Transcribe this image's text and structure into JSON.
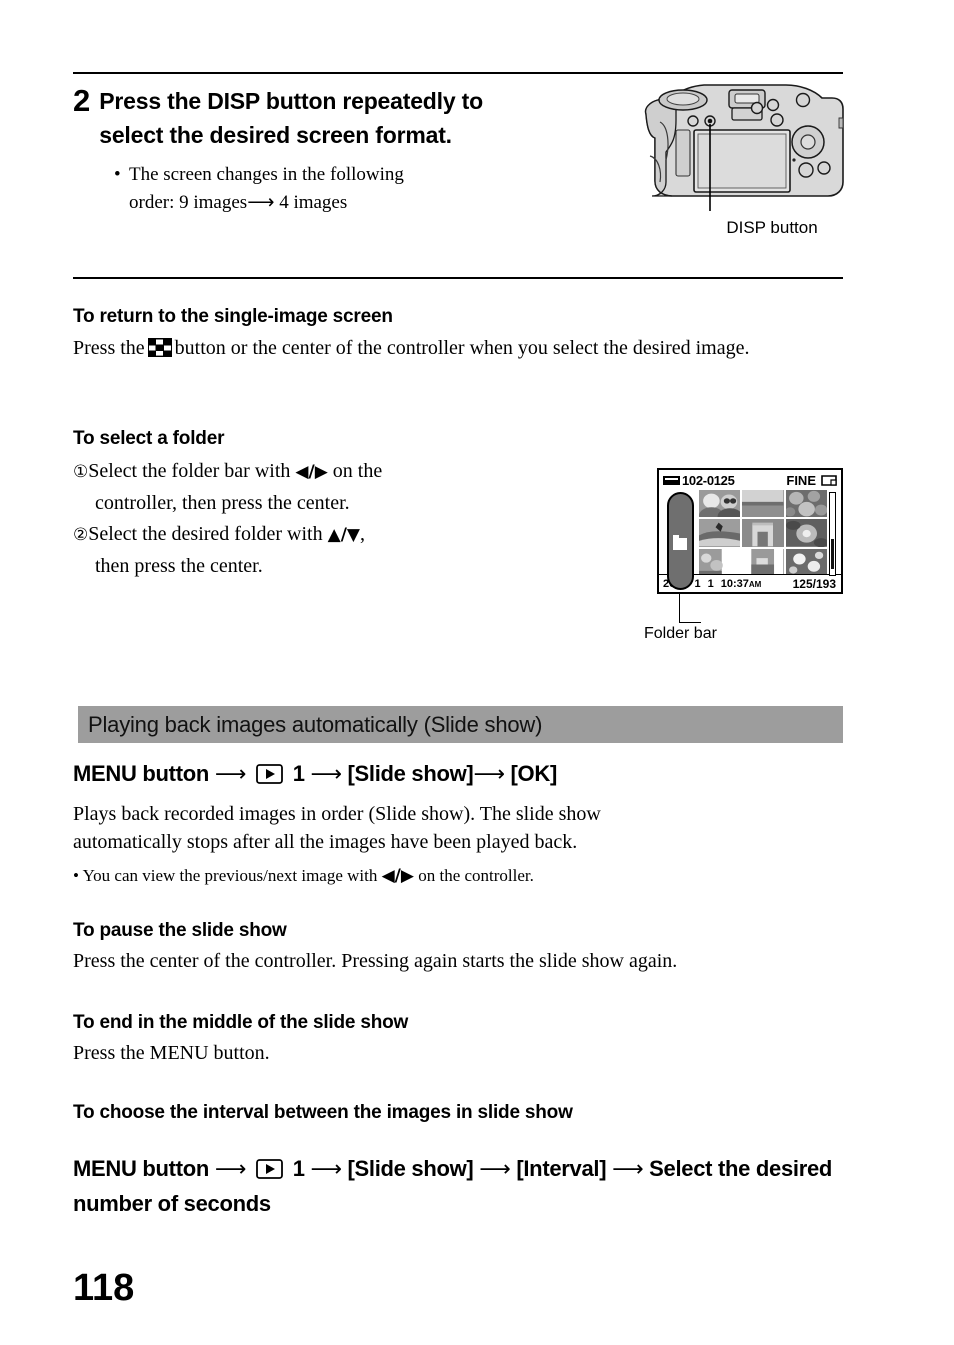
{
  "page": {
    "number": "118"
  },
  "step": {
    "number": "2",
    "title": "Press the DISP button repeatedly to select the desired screen format.",
    "bullet_dot": "•",
    "bullet_line1": "The screen changes in the following",
    "bullet_line2_pre": "order: 9 images",
    "bullet_arrow": "⟶",
    "bullet_line2_post": "4 images"
  },
  "camera_figure": {
    "caption": "DISP button",
    "icon": "camera-rear-illustration"
  },
  "section_return": {
    "heading": "To return to the single-image screen",
    "text_before": "Press the",
    "icon_name": "index-button-icon",
    "text_after": "button or the center of the controller when you select the desired image."
  },
  "section_folder": {
    "heading": "To select a folder",
    "item1_marker": "①",
    "item1_pre": "Select the folder bar with",
    "item1_arrows": "◀/▶",
    "item1_post": "on the",
    "item1_line2": "controller, then press the center.",
    "item2_marker": "②",
    "item2_pre": "Select the desired folder with",
    "item2_arrows": "▲/▼",
    "item2_post": ",",
    "item2_line2": "then press the center."
  },
  "lcd_figure": {
    "caption": "Folder bar",
    "leader_target": "folder-bar",
    "top_bar": {
      "card_icon": "memory-card-icon",
      "folder_file_number": "102-0125",
      "quality": "FINE",
      "image_size_icon": "image-size-icon"
    },
    "bottom_bar": {
      "year": "2009",
      "month": "1",
      "day": "1",
      "time": "10:37",
      "ampm": "AM",
      "counter": "125/193"
    },
    "thumbnails": [
      "two-children-portrait",
      "seascape-horizon",
      "green-fruit-closeup",
      "surfer-on-wave",
      "arc-de-triomphe",
      "pink-hibiscus-flower",
      "flowers-partial",
      "boat-partial",
      "white-blossoms"
    ]
  },
  "banner": {
    "title": "Playing back images automatically (Slide show)"
  },
  "menu_path_1": {
    "label": "MENU button",
    "arrow": "⟶",
    "playback_icon": "playback-menu-icon",
    "page_num": "1",
    "item1": "[Slide show]",
    "item2": "[OK]"
  },
  "intro": {
    "line1": "Plays back recorded images in order (Slide show). The slide show",
    "line2": "automatically stops after all the images have been played back.",
    "bullet_dot": "•",
    "bullet_pre": "You can view the previous/next image with",
    "bullet_arrows": "◀/▶",
    "bullet_post": "on the controller."
  },
  "section_pause": {
    "heading": "To pause the slide show",
    "body": "Press the center of the controller. Pressing again starts the slide show again."
  },
  "section_end": {
    "heading": "To end in the middle of the slide show",
    "body": "Press the MENU button."
  },
  "section_interval": {
    "heading": "To choose the interval between the images in slide show"
  },
  "menu_path_2": {
    "label": "MENU button",
    "arrow": "⟶",
    "playback_icon": "playback-menu-icon",
    "page_num": "1",
    "item1": "[Slide show]",
    "item2": "[Interval]",
    "tail_line1": "Select",
    "tail_line2": "the desired number of seconds"
  },
  "colors": {
    "banner_gray": "#9d9d9d",
    "text_black": "#000000",
    "lcd_gray": "#8a8a8a"
  }
}
